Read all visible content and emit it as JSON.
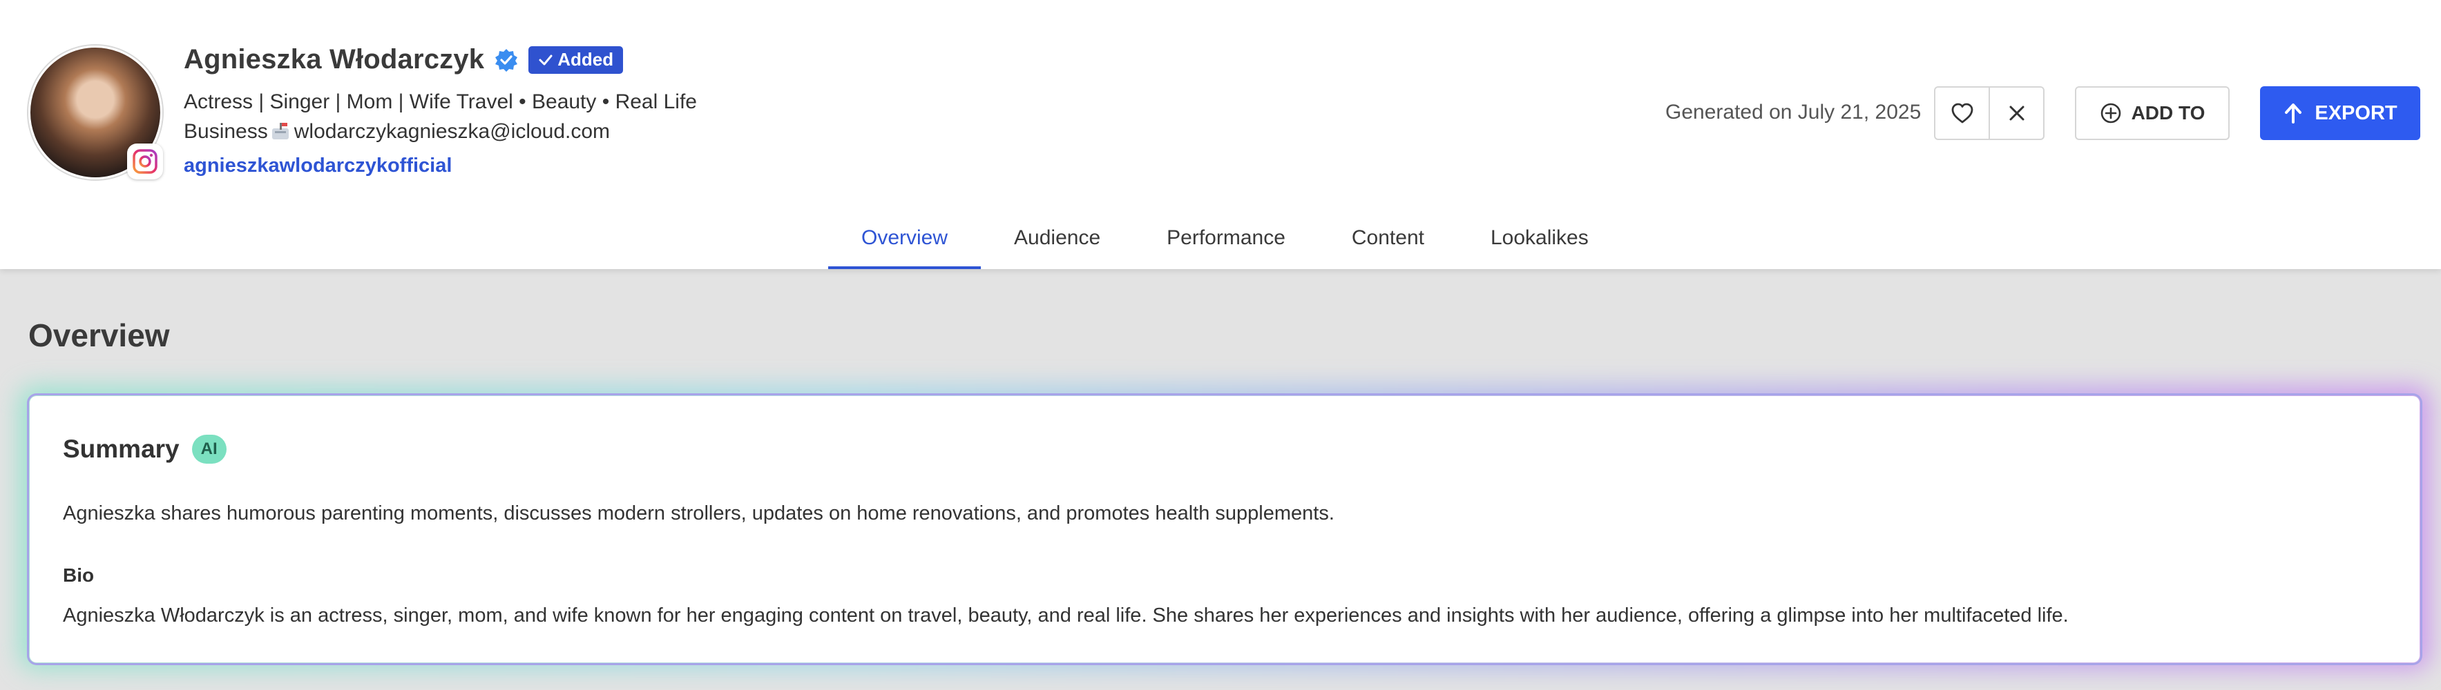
{
  "profile": {
    "name": "Agnieszka Włodarczyk",
    "added_label": "Added",
    "bio": "Actress | Singer | Mom | Wife Travel • Beauty • Real Life",
    "business_prefix": "Business",
    "business_email": "wlodarczykagnieszka@icloud.com",
    "handle": "agnieszkawlodarczykofficial",
    "platform_icon": "instagram-icon"
  },
  "header": {
    "generated": "Generated on July 21, 2025",
    "add_to_label": "ADD TO",
    "export_label": "EXPORT"
  },
  "tabs": [
    {
      "label": "Overview",
      "active": true
    },
    {
      "label": "Audience",
      "active": false
    },
    {
      "label": "Performance",
      "active": false
    },
    {
      "label": "Content",
      "active": false
    },
    {
      "label": "Lookalikes",
      "active": false
    }
  ],
  "overview": {
    "title": "Overview",
    "summary_title": "Summary",
    "ai_badge": "AI",
    "summary_text": "Agnieszka shares humorous parenting moments, discusses modern strollers, updates on home renovations, and promotes health supplements.",
    "bio_label": "Bio",
    "bio_text": "Agnieszka Włodarczyk is an actress, singer, mom, and wife known for her engaging content on travel, beauty, and real life. She shares her experiences and insights with her audience, offering a glimpse into her multifaceted life."
  },
  "colors": {
    "accent": "#2e54d4",
    "export_bg": "#2e5bf0",
    "added_bg": "#2f52cf",
    "ai_badge_bg": "#7be0c0"
  }
}
